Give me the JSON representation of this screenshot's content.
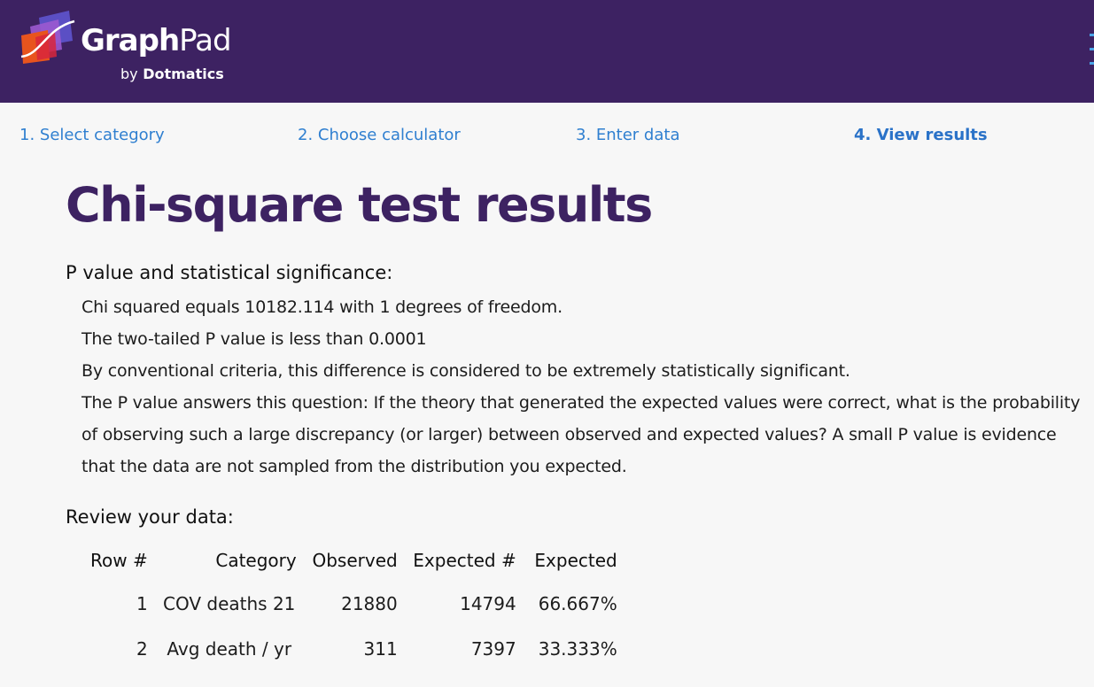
{
  "brand": {
    "name_bold": "Graph",
    "name_light": "Pad",
    "by_prefix": "by",
    "company": "Dotmatics",
    "colors": {
      "header_bg": "#3d2262",
      "link": "#2f7fd0",
      "title": "#3d2262"
    }
  },
  "steps": [
    {
      "label": "1. Select category",
      "active": false
    },
    {
      "label": "2. Choose calculator",
      "active": false
    },
    {
      "label": "3. Enter data",
      "active": false
    },
    {
      "label": "4. View results",
      "active": true
    }
  ],
  "page_title": "Chi-square test results",
  "significance": {
    "heading": "P value and statistical significance:",
    "lines": [
      "Chi squared equals 10182.114 with 1 degrees of freedom.",
      "The two-tailed P value is less than 0.0001",
      "By conventional criteria, this difference is considered to be extremely statistically significant.",
      "The P value answers this question: If the theory that generated the expected values were correct, what is the probability of observing such a large discrepancy (or larger) between observed and expected values? A small P value is evidence that the data are not sampled from the distribution you expected."
    ]
  },
  "review": {
    "heading": "Review your data:",
    "columns": [
      "Row #",
      "Category",
      "Observed",
      "Expected #",
      "Expected"
    ],
    "rows": [
      [
        "1",
        "COV deaths 21",
        "21880",
        "14794",
        "66.667%"
      ],
      [
        "2",
        "Avg death / yr",
        "311",
        "7397",
        "33.333%"
      ]
    ]
  }
}
